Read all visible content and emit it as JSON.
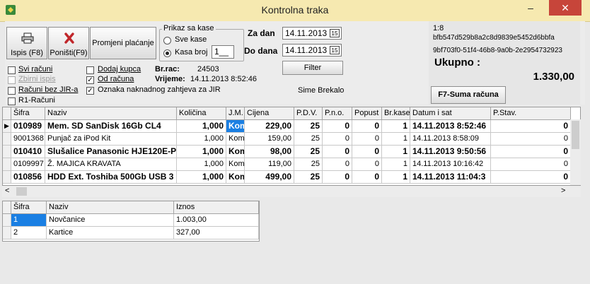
{
  "window": {
    "title": "Kontrolna traka",
    "min": "–",
    "max": "☐",
    "close": "✕"
  },
  "toolbar": {
    "print_label": "Ispis (F8)",
    "cancel_label": "Poništi(F9)",
    "change_payment_label": "Promjeni  plaćanje"
  },
  "display_group": {
    "title": "Prikaz sa kase",
    "all_label": "Sve kase",
    "one_label": "Kasa broj",
    "register_value": "1__",
    "selected": "one"
  },
  "dates": {
    "from_label": "Za dan",
    "from_value": "14.11.2013",
    "to_label": "Do dana",
    "to_value": "14.11.2013",
    "filter_label": "Filter"
  },
  "checks": {
    "all_bills": "Svi računi",
    "summary_print": "Zbirni ispis",
    "no_jir": "Računi bez JIR-a",
    "r1": "R1-Računi",
    "add_customer": "Dodaj kupca",
    "from_bill": "Od računa",
    "jir_flag": "Oznaka naknadnog zahtjeva za JIR",
    "from_bill_checked": true,
    "jir_flag_checked": true
  },
  "bill_info": {
    "rac_label": "Br.rac:",
    "rac_value": "24503",
    "time_label": "Vrijeme:",
    "time_value": "14.11.2013 8:52:46",
    "operator": "Sime Brekalo"
  },
  "summary": {
    "code": "1:8",
    "hash1": "bfb547d529b8a2c8d9839e5452d6bbfa",
    "hash2": "9bf703f0-51f4-46b8-9a0b-2e2954732923",
    "total_label": "Ukupno :",
    "total_value": "1.330,00",
    "sum_button": "F7-Suma računa"
  },
  "items_table": {
    "headers": [
      "Šifra",
      "Naziv",
      "Količina",
      "J.M.",
      "Cijena",
      "P.D.V.",
      "P.n.o.",
      "Popust",
      "Br.kase",
      "Datum i sat",
      "P.Stav."
    ],
    "rows": [
      {
        "bold": true,
        "cells": [
          "010989",
          "Mem. SD SanDisk 16Gb CL4",
          "1,000",
          "Kom",
          "229,00",
          "25",
          "0",
          "0",
          "1",
          "14.11.2013 8:52:46",
          "0"
        ]
      },
      {
        "bold": false,
        "cells": [
          "9001368",
          "Punjač za iPod Kit",
          "1,000",
          "Kom",
          "159,00",
          "25",
          "0",
          "0",
          "1",
          "14.11.2013 8:58:09",
          "0"
        ]
      },
      {
        "bold": true,
        "cells": [
          "010410",
          "Slušalice Panasonic HJE120E-P",
          "1,000",
          "Kom",
          "98,00",
          "25",
          "0",
          "0",
          "1",
          "14.11.2013 9:50:56",
          "0"
        ]
      },
      {
        "bold": false,
        "cells": [
          "0109997",
          "Ž. MAJICA KRAVATA",
          "1,000",
          "Kom",
          "119,00",
          "25",
          "0",
          "0",
          "1",
          "14.11.2013 10:16:42",
          "0"
        ]
      },
      {
        "bold": true,
        "cells": [
          "010856",
          "HDD Ext. Toshiba 500Gb USB 3",
          "1,000",
          "Kom",
          "499,00",
          "25",
          "0",
          "0",
          "1",
          "14.11.2013 11:04:3",
          "0"
        ]
      }
    ]
  },
  "payments_table": {
    "headers": [
      "Šifra",
      "Naziv",
      "Iznos"
    ],
    "rows": [
      [
        "1",
        "Novčanice",
        "1.003,00"
      ],
      [
        "2",
        "Kartice",
        "327,00"
      ]
    ]
  }
}
